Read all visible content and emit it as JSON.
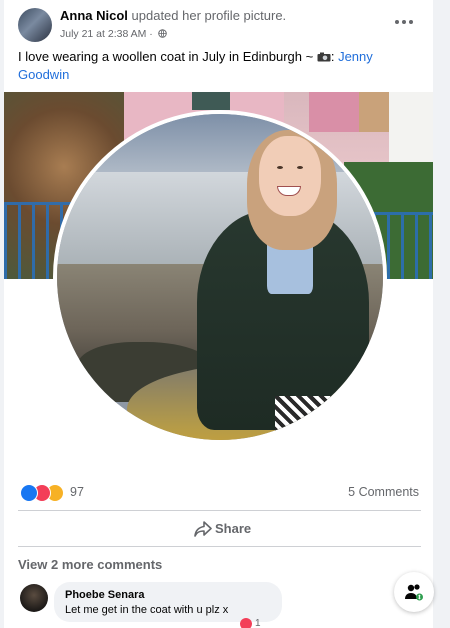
{
  "post": {
    "author": "Anna Nicol",
    "action": " updated her profile picture.",
    "timestamp": "July 21 at 2:38 AM",
    "separator": " · ",
    "privacy_icon": "globe-icon",
    "caption_text": "I love wearing a woollen coat in July in Edinburgh ~ ",
    "caption_emoji": "camera-icon",
    "caption_tag_sep": ": ",
    "tagged_user": "Jenny Goodwin"
  },
  "stats": {
    "reaction_icons": [
      "like-icon",
      "love-icon",
      "haha-icon"
    ],
    "reaction_count": "97",
    "comments_label": "5 Comments"
  },
  "actions": {
    "share_label": "Share"
  },
  "comments": {
    "view_more_label": "View 2 more comments",
    "items": [
      {
        "author": "Phoebe Senara",
        "text": "Let me get in the coat with u plz x",
        "reaction_count": "1"
      }
    ]
  },
  "colors": {
    "link": "#216fdb",
    "like": "#1877f2",
    "love": "#f33e58",
    "haha": "#f7b125",
    "secondary_text": "#65676b"
  },
  "fab": {
    "icon": "people-money-icon"
  }
}
